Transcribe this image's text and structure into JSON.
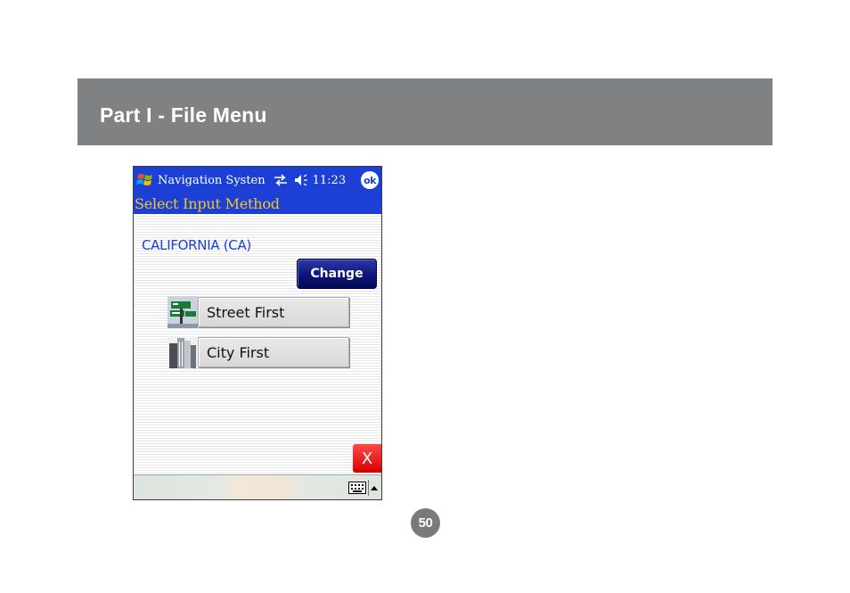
{
  "document": {
    "section_title": "Part I - File Menu",
    "page_number": "50"
  },
  "device": {
    "taskbar": {
      "start_icon": "windows-flag-icon",
      "title": "Navigation Systen",
      "sync_icon": "sync-arrows-icon",
      "volume_icon": "speaker-icon",
      "time": "11:23",
      "ok_label": "ok"
    },
    "screen_title": "Select Input Method",
    "state_label": "CALIFORNIA (CA)",
    "change_label": "Change",
    "options": [
      {
        "label": "Street First",
        "icon": "street-sign-icon"
      },
      {
        "label": "City First",
        "icon": "city-buildings-icon"
      }
    ],
    "close_label": "X",
    "bottom_bar": {
      "keyboard_icon": "keyboard-icon",
      "sip_arrow_icon": "arrow-up-icon"
    }
  },
  "colors": {
    "header_band": "#7f8183",
    "taskbar_blue": "#1c40d6",
    "title_yellow": "#f3c623",
    "change_button": "#0c157a",
    "close_red": "#e01010",
    "page_badge": "#7a7a7a"
  }
}
